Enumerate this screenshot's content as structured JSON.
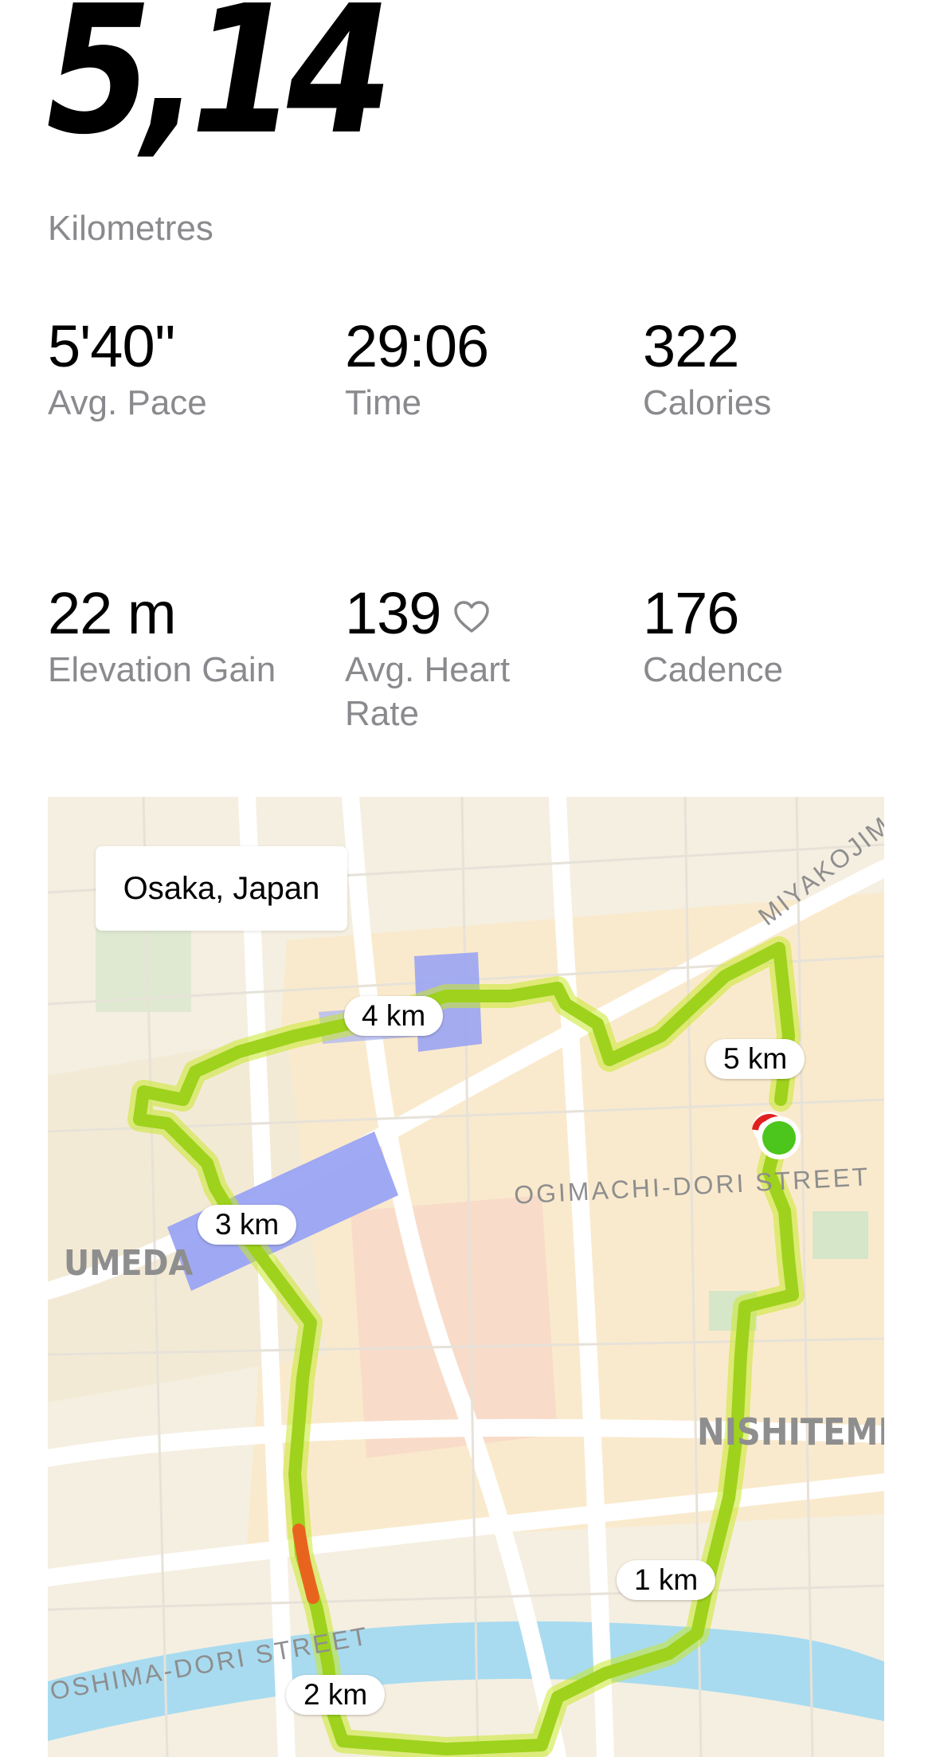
{
  "summary": {
    "distance": "5,14",
    "distance_unit": "Kilometres"
  },
  "stats": [
    {
      "value": "5'40''",
      "label": "Avg. Pace"
    },
    {
      "value": "29:06",
      "label": "Time"
    },
    {
      "value": "322",
      "label": "Calories"
    },
    {
      "value": "22 m",
      "label": "Elevation Gain"
    },
    {
      "value": "139",
      "label": "Avg. Heart Rate",
      "icon": "heart-icon"
    },
    {
      "value": "176",
      "label": "Cadence"
    }
  ],
  "map": {
    "location": "Osaka, Japan",
    "km_markers": [
      "1 km",
      "2 km",
      "3 km",
      "4 km",
      "5 km"
    ],
    "area_labels": [
      "UMEDA",
      "NISHITEMM"
    ],
    "street_labels": [
      "OGIMACHI-DORI STREET",
      "OSHIMA-DORI STREET",
      "MIYAKOJIM"
    ],
    "colors": {
      "route": "#9ed21d",
      "route_fast": "#e8641e",
      "start": "#4cc61c",
      "end": "#e02020",
      "water": "#a8dbf0"
    }
  }
}
